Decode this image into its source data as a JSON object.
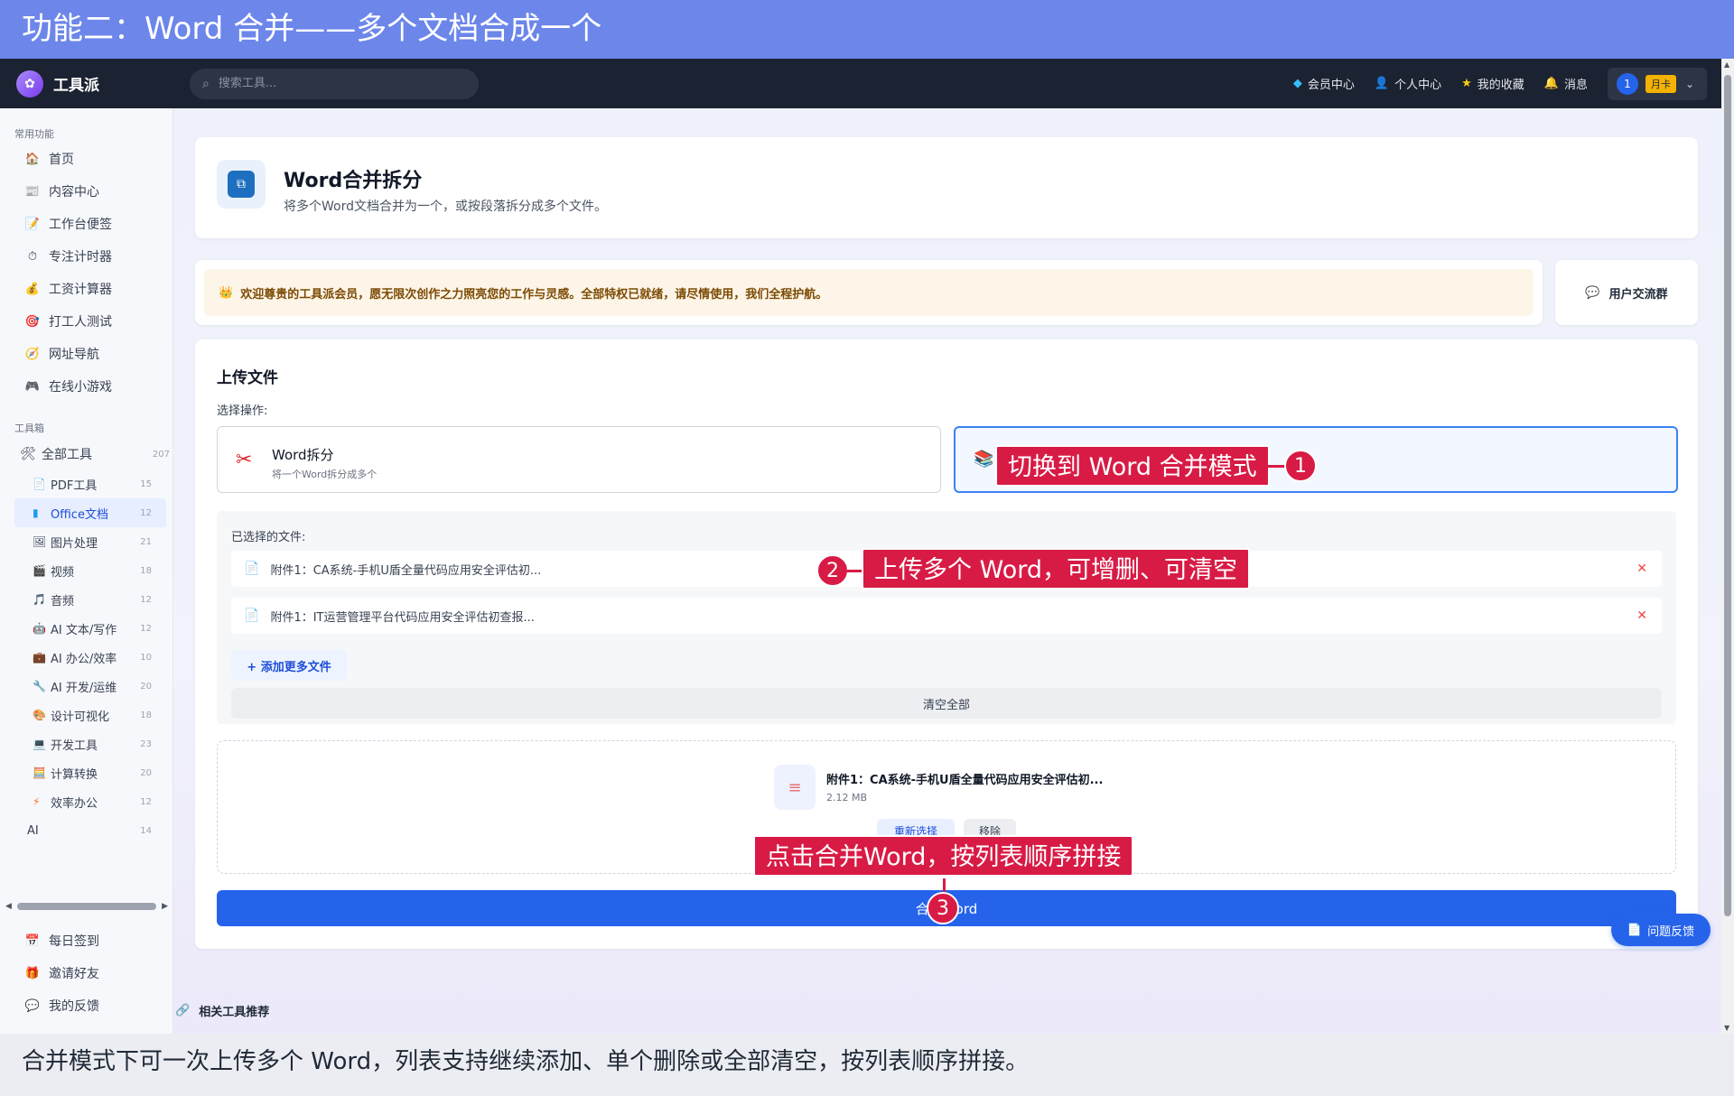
{
  "banner": {
    "title": "功能二：Word 合并——多个文档合成一个"
  },
  "navbar": {
    "app_name": "工具派",
    "search_placeholder": "搜索工具...",
    "items": [
      {
        "label": "会员中心",
        "icon": "diamond-icon"
      },
      {
        "label": "个人中心",
        "icon": "user-icon"
      },
      {
        "label": "我的收藏",
        "icon": "star-icon"
      },
      {
        "label": "消息",
        "icon": "bell-icon"
      }
    ],
    "user": {
      "avatar_text": "1",
      "badge": "月卡"
    }
  },
  "sidebar": {
    "section_common": "常用功能",
    "common_items": [
      {
        "label": "首页",
        "icon": "🏠"
      },
      {
        "label": "内容中心",
        "icon": "📰"
      },
      {
        "label": "工作台便签",
        "icon": "📝"
      },
      {
        "label": "专注计时器",
        "icon": "⏱"
      },
      {
        "label": "工资计算器",
        "icon": "💰"
      },
      {
        "label": "打工人测试",
        "icon": "🎯"
      },
      {
        "label": "网址导航",
        "icon": "🧭"
      },
      {
        "label": "在线小游戏",
        "icon": "🎮"
      }
    ],
    "section_tools": "工具箱",
    "all_tools": {
      "label": "全部工具",
      "count": "207"
    },
    "tool_items": [
      {
        "label": "PDF工具",
        "count": "15",
        "icon": "📄"
      },
      {
        "label": "Office文档",
        "count": "12",
        "icon": "📘",
        "active": true
      },
      {
        "label": "图片处理",
        "count": "21",
        "icon": "🖼"
      },
      {
        "label": "视频",
        "count": "18",
        "icon": "🎬"
      },
      {
        "label": "音频",
        "count": "12",
        "icon": "🎵"
      },
      {
        "label": "AI 文本/写作",
        "count": "12",
        "icon": "🤖"
      },
      {
        "label": "AI 办公/效率",
        "count": "10",
        "icon": "💼"
      },
      {
        "label": "AI 开发/运维",
        "count": "20",
        "icon": "🔧"
      },
      {
        "label": "设计可视化",
        "count": "18",
        "icon": "🎨"
      },
      {
        "label": "开发工具",
        "count": "23",
        "icon": "💻"
      },
      {
        "label": "计算转换",
        "count": "20",
        "icon": "🧮"
      },
      {
        "label": "效率办公",
        "count": "12",
        "icon": "⚡"
      },
      {
        "label": "AI",
        "count": "14",
        "icon": ""
      }
    ],
    "bottom_items": [
      {
        "label": "每日签到",
        "icon": "📅"
      },
      {
        "label": "邀请好友",
        "icon": "🎁"
      },
      {
        "label": "我的反馈",
        "icon": "💬"
      }
    ]
  },
  "header": {
    "title": "Word合并拆分",
    "description": "将多个Word文档合并为一个，或按段落拆分成多个文件。"
  },
  "notice": {
    "text": "欢迎尊贵的工具派会员，愿无限次创作之力照亮您的工作与灵感。全部特权已就绪，请尽情使用，我们全程护航。",
    "group_label": "用户交流群"
  },
  "upload": {
    "title": "上传文件",
    "select_label": "选择操作:",
    "mode_split": {
      "title": "Word拆分",
      "subtitle": "将一个Word拆分成多个"
    },
    "files_label": "已选择的文件:",
    "files": [
      "附件1：CA系统-手机U盾全量代码应用安全评估初...",
      "附件1：IT运营管理平台代码应用安全评估初查报..."
    ],
    "add_more": "+ 添加更多文件",
    "clear_all": "清空全部",
    "preview": {
      "name": "附件1：CA系统-手机U盾全量代码应用安全评估初...",
      "size": "2.12 MB",
      "reselect": "重新选择",
      "remove": "移除"
    },
    "merge_button": "合并Word"
  },
  "feedback": "问题反馈",
  "related": "相关工具推荐",
  "annotations": [
    {
      "num": "1",
      "text": "切换到 Word 合并模式"
    },
    {
      "num": "2",
      "text": "上传多个 Word，可增删、可清空"
    },
    {
      "num": "3",
      "text": "点击合并Word，按列表顺序拼接"
    }
  ],
  "caption": "合并模式下可一次上传多个 Word，列表支持继续添加、单个删除或全部清空，按列表顺序拼接。",
  "colors": {
    "banner": "#6c86ea",
    "navbar": "#1b2231",
    "primary": "#2563eb",
    "annotation": "#d81b45"
  }
}
